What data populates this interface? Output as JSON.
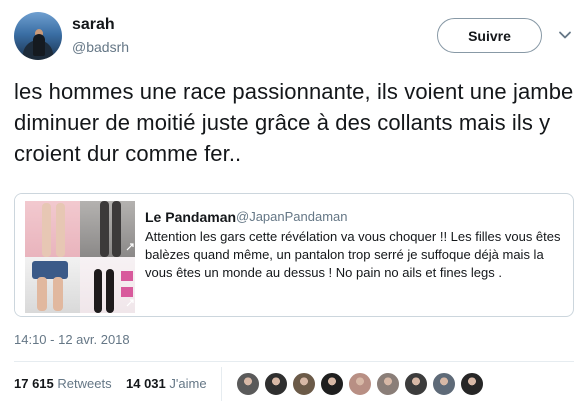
{
  "tweet": {
    "author_name": "sarah",
    "author_handle": "@badsrh",
    "follow_label": "Suivre",
    "text": "les hommes une race passionnante,  ils voient une jambe diminuer de moitié juste grâce à des collants mais ils y croient dur comme fer..",
    "timestamp": "14:10 - 12 avr. 2018"
  },
  "quoted": {
    "name": "Le Pandaman",
    "handle": "@JapanPandaman",
    "text": "Attention les gars cette révélation va vous choquer !! Les filles vous êtes balèzes quand même, un pantalon trop serré je suffoque déjà mais la vous êtes un monde au dessus ! No pain no ails et fines legs ."
  },
  "stats": {
    "retweets_count": "17 615",
    "retweets_label": "Retweets",
    "likes_count": "14 031",
    "likes_label": "J'aime"
  },
  "likers": [
    {
      "icon": "avatar",
      "color": "#5a5a5a"
    },
    {
      "icon": "avatar",
      "color": "#2f2f2f"
    },
    {
      "icon": "avatar",
      "color": "#6b5a48"
    },
    {
      "icon": "avatar",
      "color": "#1f1f1f"
    },
    {
      "icon": "avatar",
      "color": "#b88f84"
    },
    {
      "icon": "avatar",
      "color": "#8a7e78"
    },
    {
      "icon": "avatar",
      "color": "#3c3c3c"
    },
    {
      "icon": "avatar",
      "color": "#5e6a78"
    },
    {
      "icon": "avatar",
      "color": "#262626"
    }
  ],
  "colors": {
    "text_primary": "#14171a",
    "text_secondary": "#657786",
    "border": "#ccd6dd"
  }
}
